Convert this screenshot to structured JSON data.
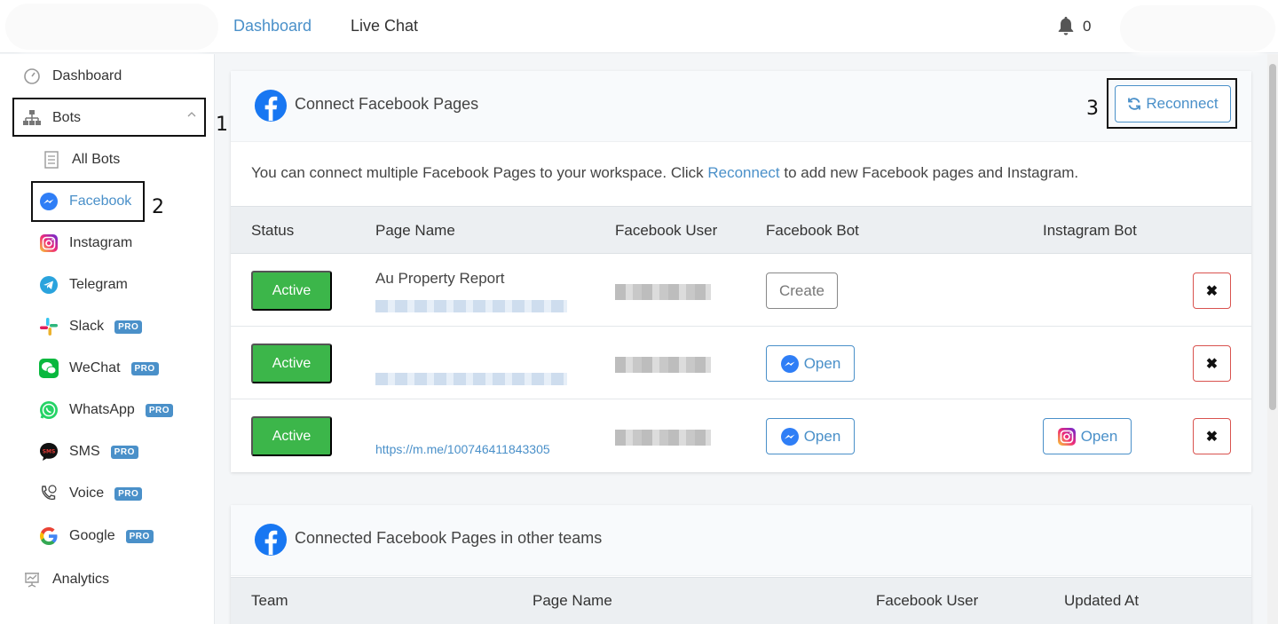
{
  "topbar": {
    "nav": [
      {
        "label": "Dashboard"
      },
      {
        "label": "Live Chat"
      }
    ],
    "notification_count": "0"
  },
  "sidebar": {
    "items": [
      {
        "label": "Dashboard",
        "icon": "speedometer-icon"
      },
      {
        "label": "Bots",
        "icon": "sitemap-icon"
      },
      {
        "label": "All Bots",
        "icon": "list-icon"
      },
      {
        "label": "Facebook",
        "icon": "messenger-icon"
      },
      {
        "label": "Instagram",
        "icon": "instagram-icon"
      },
      {
        "label": "Telegram",
        "icon": "telegram-icon"
      },
      {
        "label": "Slack",
        "icon": "slack-icon",
        "badge": "PRO"
      },
      {
        "label": "WeChat",
        "icon": "wechat-icon",
        "badge": "PRO"
      },
      {
        "label": "WhatsApp",
        "icon": "whatsapp-icon",
        "badge": "PRO"
      },
      {
        "label": "SMS",
        "icon": "sms-icon",
        "badge": "PRO"
      },
      {
        "label": "Voice",
        "icon": "voice-icon",
        "badge": "PRO"
      },
      {
        "label": "Google",
        "icon": "google-icon",
        "badge": "PRO"
      },
      {
        "label": "Analytics",
        "icon": "analytics-icon"
      }
    ],
    "annotations": [
      "1",
      "2"
    ]
  },
  "connect_card": {
    "title": "Connect Facebook Pages",
    "reconnect_label": "Reconnect",
    "annotation": "3",
    "description_before": "You can connect multiple Facebook Pages to your workspace. Click ",
    "description_link": "Reconnect",
    "description_after": " to add new Facebook pages and Instagram.",
    "columns": [
      "Status",
      "Page Name",
      "Facebook User",
      "Facebook Bot",
      "Instagram Bot"
    ],
    "rows": [
      {
        "status": "Active",
        "page_name": "Au Property Report",
        "page_link": "",
        "facebook_bot": "Create",
        "instagram_bot": ""
      },
      {
        "status": "Active",
        "page_name": "",
        "page_link": "",
        "facebook_bot": "Open",
        "instagram_bot": ""
      },
      {
        "status": "Active",
        "page_name": "",
        "page_link": "https://m.me/100746411843305",
        "facebook_bot": "Open",
        "instagram_bot": "Open"
      }
    ],
    "delete_label": "✖"
  },
  "other_teams_card": {
    "title": "Connected Facebook Pages in other teams",
    "columns": [
      "Team",
      "Page Name",
      "Facebook User",
      "Updated At"
    ]
  },
  "colors": {
    "accent": "#4a90c9",
    "active_green": "#3cb64a",
    "danger": "#d9534f",
    "facebook_blue": "#1877f2"
  }
}
